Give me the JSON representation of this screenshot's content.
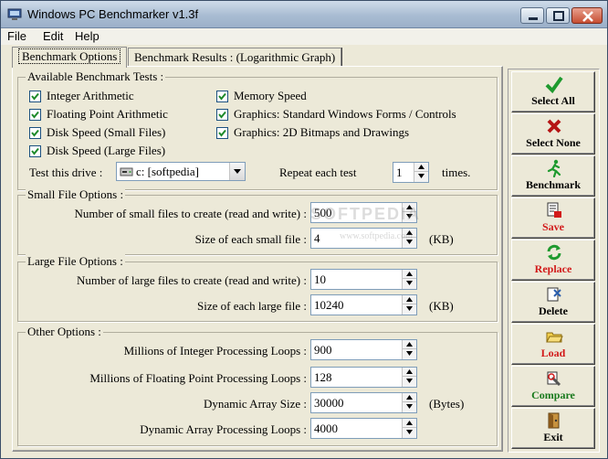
{
  "window": {
    "title": "Windows PC Benchmarker v1.3f"
  },
  "menu": {
    "items": [
      "File",
      "Edit",
      "Help"
    ]
  },
  "tabs": [
    {
      "label": "Benchmark Options",
      "active": true
    },
    {
      "label": "Benchmark Results : (Logarithmic Graph)",
      "active": false
    }
  ],
  "available_tests": {
    "label": "Available Benchmark Tests :",
    "items": [
      {
        "label": "Integer Arithmetic",
        "checked": true
      },
      {
        "label": "Floating Point Arithmetic",
        "checked": true
      },
      {
        "label": "Disk Speed (Small Files)",
        "checked": true
      },
      {
        "label": "Disk Speed (Large Files)",
        "checked": true
      },
      {
        "label": "Memory Speed",
        "checked": true
      },
      {
        "label": "Graphics: Standard Windows Forms / Controls",
        "checked": true
      },
      {
        "label": "Graphics: 2D Bitmaps and Drawings",
        "checked": true
      }
    ],
    "drive_label": "Test this drive :",
    "drive_value": "c: [softpedia]",
    "repeat_label": "Repeat each test",
    "repeat_value": "1",
    "repeat_suffix": "times."
  },
  "small_files": {
    "label": "Small File Options :",
    "count_label": "Number of small files to create (read and write) :",
    "count_value": "500",
    "size_label": "Size of each small file :",
    "size_value": "4",
    "size_unit": "(KB)"
  },
  "large_files": {
    "label": "Large File Options :",
    "count_label": "Number of large files to create (read and write) :",
    "count_value": "10",
    "size_label": "Size of each large file :",
    "size_value": "10240",
    "size_unit": "(KB)"
  },
  "other": {
    "label": "Other Options :",
    "int_label": "Millions of Integer Processing Loops :",
    "int_value": "900",
    "float_label": "Millions of Floating Point Processing Loops :",
    "float_value": "128",
    "array_size_label": "Dynamic Array Size :",
    "array_size_value": "30000",
    "array_size_unit": "(Bytes)",
    "array_loops_label": "Dynamic Array Processing Loops :",
    "array_loops_value": "4000"
  },
  "sidebar": [
    {
      "label": "Select All",
      "icon": "check-icon",
      "color": "#000000"
    },
    {
      "label": "Select None",
      "icon": "x-icon",
      "color": "#000000"
    },
    {
      "label": "Benchmark",
      "icon": "runner-icon",
      "color": "#000000"
    },
    {
      "label": "Save",
      "icon": "save-icon",
      "color": "#d21a1a"
    },
    {
      "label": "Replace",
      "icon": "replace-icon",
      "color": "#d21a1a"
    },
    {
      "label": "Delete",
      "icon": "delete-icon",
      "color": "#000000"
    },
    {
      "label": "Load",
      "icon": "folder-icon",
      "color": "#d21a1a"
    },
    {
      "label": "Compare",
      "icon": "compare-icon",
      "color": "#18791c"
    },
    {
      "label": "Exit",
      "icon": "exit-icon",
      "color": "#000000"
    }
  ],
  "watermark": {
    "text": "SOFTPEDIA",
    "url": "www.softpedia.com"
  }
}
